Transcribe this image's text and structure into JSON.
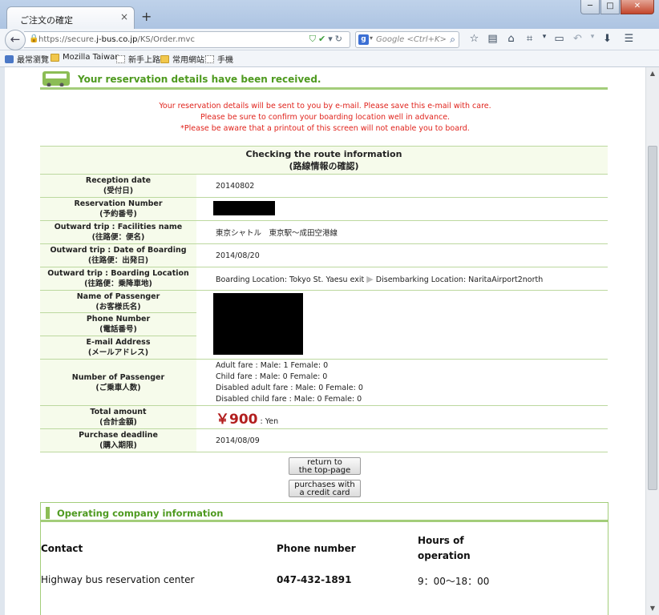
{
  "browser": {
    "tab_title": "ご注文の確定",
    "tab_close": "×",
    "new_tab": "+",
    "url_prefix": "https://secure.",
    "url_domain": "j-bus.co.jp",
    "url_path": "/KS/Order.mvc",
    "search_placeholder": "Google <Ctrl+K>",
    "search_engine_icon": "g-icon",
    "bookmarks": [
      "最常瀏覽",
      "Mozilla Taiwan",
      "新手上路",
      "常用網站",
      "手機"
    ]
  },
  "page": {
    "header_title": "Your reservation details have been received.",
    "notices": [
      "Your reservation details will be sent to you by e-mail. Please save this e-mail with care.",
      "Please be sure to confirm your boarding location well in advance.",
      "*Please be aware that a printout of this screen will not enable you to board."
    ],
    "route": {
      "title": "Checking the route information",
      "title_ja": "(路線情報の確認)",
      "rows": [
        {
          "en": "Reception date",
          "ja": "(受付日)",
          "value": "20140802"
        },
        {
          "en": "Reservation Number",
          "ja": "(予約番号)"
        },
        {
          "en": "Outward trip : Facilities name",
          "ja": "(往路便：便名)",
          "value": "東京シャトル　東京駅～成田空港線"
        },
        {
          "en": "Outward trip : Date of Boarding",
          "ja": "(往路便：出発日)",
          "value": "2014/08/20"
        },
        {
          "en": "Outward trip : Boarding Location",
          "ja": "(往路便：乗降車地)",
          "boarding": "Boarding Location: Tokyo St. Yaesu exit",
          "disembark": "Disembarking Location: NaritaAirport2north"
        },
        {
          "en": "Name of Passenger",
          "ja": "(お客様氏名)"
        },
        {
          "en": "Phone Number",
          "ja": "(電話番号)"
        },
        {
          "en": "E-mail Address",
          "ja": "(メールアドレス)"
        },
        {
          "en": "Number of Passenger",
          "ja": "(ご乗車人数)",
          "fares": [
            "Adult fare :  Male: 1  Female: 0",
            "Child fare :  Male: 0  Female: 0",
            "Disabled adult fare :  Male: 0  Female: 0",
            "Disabled child fare :  Male: 0  Female: 0"
          ]
        },
        {
          "en": "Total amount",
          "ja": "(合計金額)",
          "amount": "￥900",
          "unit": ": Yen"
        },
        {
          "en": "Purchase deadline",
          "ja": "(購入期限)",
          "value": "2014/08/09"
        }
      ]
    },
    "buttons": {
      "top_page": [
        "return to",
        "the top-page"
      ],
      "credit_card": [
        "purchases with",
        "a credit card"
      ]
    },
    "operating": {
      "title": "Operating company information",
      "col_contact": "Contact",
      "col_phone": "Phone number",
      "col_hours_1": "Hours of",
      "col_hours_2": "operation",
      "contact": "Highway bus reservation center",
      "phone": "047-432-1891",
      "hours": "9：00～18：00"
    }
  },
  "colors": {
    "accent_green": "#4e9a1f",
    "border_green": "#a3cd7a",
    "notice_red": "#e0231c",
    "amount_red": "#b21e1e"
  }
}
